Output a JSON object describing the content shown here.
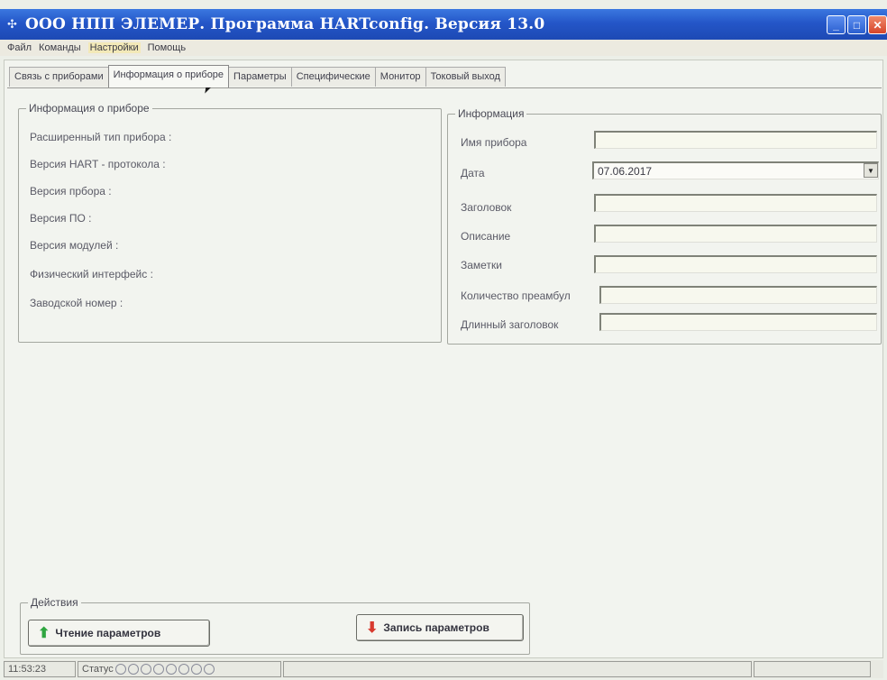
{
  "window": {
    "title": "ООО НПП ЭЛЕМЕР.  Программа HARTconfig.  Версия 13.0"
  },
  "menu": [
    "Файл",
    "Команды",
    "Настройки",
    "Помощь"
  ],
  "tabs": [
    "Связь с приборами",
    "Информация о приборе",
    "Параметры",
    "Специфические",
    "Монитор",
    "Токовый выход"
  ],
  "device_info": {
    "title": "Информация о приборе",
    "rows": [
      "Расширенный тип прибора :",
      "Версия HART - протокола :",
      "Версия прбора :",
      "Версия ПО :",
      "Версия модулей :",
      "Физический интерфейс :",
      "Заводской номер :"
    ]
  },
  "info": {
    "title": "Информация",
    "fields": [
      {
        "label": "Имя прибора",
        "value": ""
      },
      {
        "label": "Дата",
        "value": "07.06.2017"
      },
      {
        "label": "Заголовок",
        "value": ""
      },
      {
        "label": "Описание",
        "value": ""
      },
      {
        "label": "Заметки",
        "value": ""
      },
      {
        "label": "Количество преамбул",
        "value": ""
      },
      {
        "label": "Длинный заголовок",
        "value": ""
      }
    ]
  },
  "actions": {
    "title": "Действия",
    "read_label": "Чтение параметров",
    "write_label": "Запись параметров"
  },
  "status": {
    "time": "11:53:23",
    "status_label": "Статус"
  },
  "icons": {
    "read": "arrow-up-green-icon",
    "write": "arrow-down-red-icon"
  }
}
